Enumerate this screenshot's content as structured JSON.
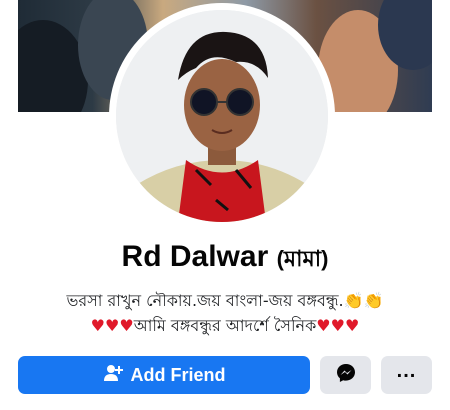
{
  "profile": {
    "name": "Rd Dalwar",
    "alternate_name": "(মামা)",
    "bio_line1": "ভরসা রাখুন নৌকায়.জয় বাংলা-জয় বঙ্গবন্ধু.",
    "bio_line2": "আমি বঙ্গবন্ধুর আদর্শে সৈনিক"
  },
  "emoji": {
    "clap": "👏👏",
    "hearts": "♥♥♥"
  },
  "actions": {
    "add_friend_label": "Add Friend"
  },
  "icons": {
    "add_friend": "person-plus-icon",
    "messenger": "messenger-icon",
    "more": "more-dots-icon"
  },
  "colors": {
    "primary": "#1877f2",
    "secondary_button": "#e4e6eb",
    "text": "#050505"
  }
}
